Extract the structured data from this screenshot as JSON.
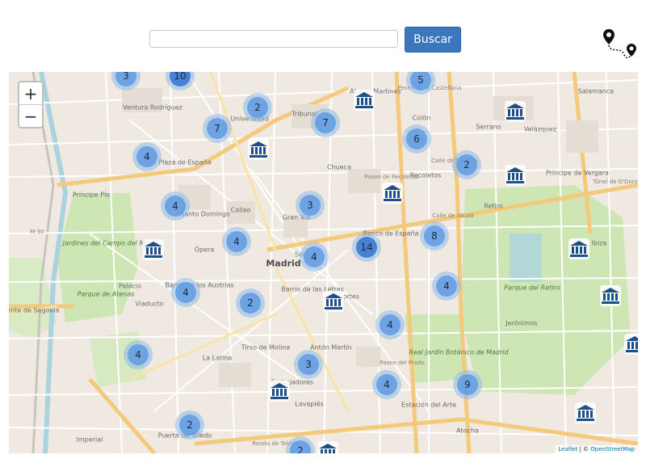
{
  "search": {
    "value": "",
    "placeholder": "",
    "button_label": "Buscar"
  },
  "route_icon": "route-pins-icon",
  "map": {
    "zoom_in_label": "+",
    "zoom_out_label": "−",
    "attribution": {
      "leaflet": "Leaflet",
      "separator": " | © ",
      "osm": "OpenStreetMap"
    },
    "colors": {
      "cluster_outer": "#8cb9eb",
      "cluster_inner": "#5f9be1",
      "museum_icon": "#1d4f8a",
      "park": "#cde6b4",
      "road_major": "#f5c97b",
      "water": "#aad3df"
    },
    "labels": [
      {
        "text": "Madrid",
        "cls": "big"
      },
      {
        "text": "Salamanca",
        "cls": ""
      },
      {
        "text": "Universidad",
        "cls": ""
      },
      {
        "text": "Ventura Rodríguez",
        "cls": ""
      },
      {
        "text": "Plaza de España",
        "cls": ""
      },
      {
        "text": "Príncipe Pío",
        "cls": ""
      },
      {
        "text": "Jardines del Campo del Moro",
        "cls": "park"
      },
      {
        "text": "Parque de Atenas",
        "cls": "park"
      },
      {
        "text": "Palacio",
        "cls": ""
      },
      {
        "text": "Ópera",
        "cls": ""
      },
      {
        "text": "Santo Domingo",
        "cls": ""
      },
      {
        "text": "Callao",
        "cls": ""
      },
      {
        "text": "Gran Vía",
        "cls": ""
      },
      {
        "text": "Sol",
        "cls": ""
      },
      {
        "text": "Tribunal",
        "cls": ""
      },
      {
        "text": "Chueca",
        "cls": ""
      },
      {
        "text": "Alonso Martínez",
        "cls": ""
      },
      {
        "text": "Colón",
        "cls": ""
      },
      {
        "text": "Recoletos",
        "cls": ""
      },
      {
        "text": "Serrano",
        "cls": ""
      },
      {
        "text": "Velázquez",
        "cls": ""
      },
      {
        "text": "Retiro",
        "cls": ""
      },
      {
        "text": "Príncipe de Vergara",
        "cls": ""
      },
      {
        "text": "Ibiza",
        "cls": ""
      },
      {
        "text": "Parque del Retiro",
        "cls": "park"
      },
      {
        "text": "Jerónimos",
        "cls": ""
      },
      {
        "text": "Real Jardín Botánico de Madrid",
        "cls": "park"
      },
      {
        "text": "Banco de España",
        "cls": ""
      },
      {
        "text": "Barrio de las Letras",
        "cls": ""
      },
      {
        "text": "Barrio de los Austrias",
        "cls": ""
      },
      {
        "text": "Viaducto",
        "cls": ""
      },
      {
        "text": "Cortes",
        "cls": ""
      },
      {
        "text": "Tirso de Molina",
        "cls": ""
      },
      {
        "text": "Antón Martín",
        "cls": ""
      },
      {
        "text": "La Latina",
        "cls": ""
      },
      {
        "text": "Embajadores",
        "cls": ""
      },
      {
        "text": "Lavapiés",
        "cls": ""
      },
      {
        "text": "Estación del Arte",
        "cls": ""
      },
      {
        "text": "Atocha",
        "cls": ""
      },
      {
        "text": "Puente de Segovia",
        "cls": ""
      },
      {
        "text": "Imperial",
        "cls": ""
      },
      {
        "text": "Puerta de Toledo",
        "cls": ""
      },
      {
        "text": "Ronda de Toledo",
        "cls": "street"
      },
      {
        "text": "Paseo del Prado",
        "cls": "street"
      },
      {
        "text": "Calle de Alcalá",
        "cls": "street"
      },
      {
        "text": "Paseo de Recoletos",
        "cls": "street"
      },
      {
        "text": "M-30",
        "cls": "street"
      },
      {
        "text": "Túnel de O'Donnell",
        "cls": "street"
      },
      {
        "text": "Calle de Serrano",
        "cls": "street"
      },
      {
        "text": "Paseo de la Castellana",
        "cls": "street"
      }
    ],
    "clusters": [
      {
        "count": "3"
      },
      {
        "count": "10"
      },
      {
        "count": "5"
      },
      {
        "count": "2"
      },
      {
        "count": "7"
      },
      {
        "count": "7"
      },
      {
        "count": "4"
      },
      {
        "count": "6"
      },
      {
        "count": "2"
      },
      {
        "count": "4"
      },
      {
        "count": "3"
      },
      {
        "count": "4"
      },
      {
        "count": "14"
      },
      {
        "count": "8"
      },
      {
        "count": "4"
      },
      {
        "count": "4"
      },
      {
        "count": "4"
      },
      {
        "count": "2"
      },
      {
        "count": "4"
      },
      {
        "count": "4"
      },
      {
        "count": "3"
      },
      {
        "count": "4"
      },
      {
        "count": "9"
      },
      {
        "count": "2"
      },
      {
        "count": "2"
      }
    ],
    "museums": 13
  }
}
